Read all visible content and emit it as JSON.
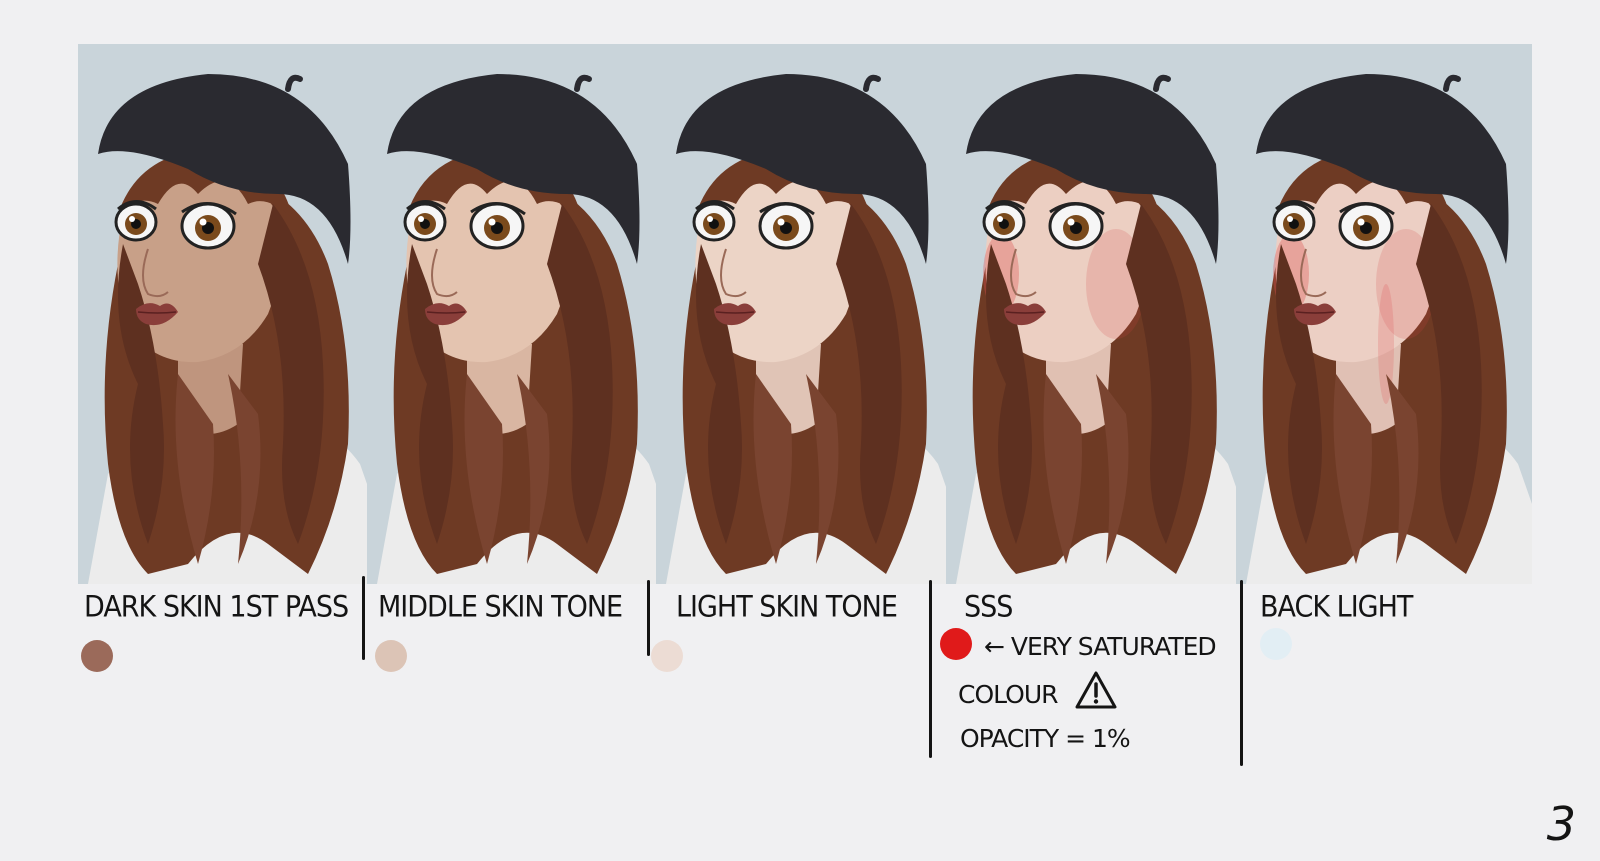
{
  "panels": [
    {
      "label": "DARK SKIN 1ST PASS",
      "swatch_color": "#9b6a5a",
      "skin_color": "#c8a088"
    },
    {
      "label": "MIDDLE SKIN TONE",
      "swatch_color": "#dcc4b6",
      "skin_color": "#e4c4b0"
    },
    {
      "label": "LIGHT SKIN TONE",
      "swatch_color": "#ecdcd4",
      "skin_color": "#ecd4c6"
    },
    {
      "label": "SSS",
      "swatch_color": "#e01a1a",
      "skin_color": "#eccfc2"
    },
    {
      "label": "BACK LIGHT",
      "swatch_color": "#e2eef4",
      "skin_color": "#eccfc4"
    }
  ],
  "sss_notes": {
    "line1": "← VERY SATURATED",
    "line2": "COLOUR",
    "line3": "OPACITY = 1%"
  },
  "page_number": "3",
  "colors": {
    "background": "#f0f0f2",
    "panel_bg": "#c9d4da",
    "beret": "#2a2a30",
    "hair": "#6e3a24",
    "sweater": "#ececec",
    "ink": "#141414"
  }
}
